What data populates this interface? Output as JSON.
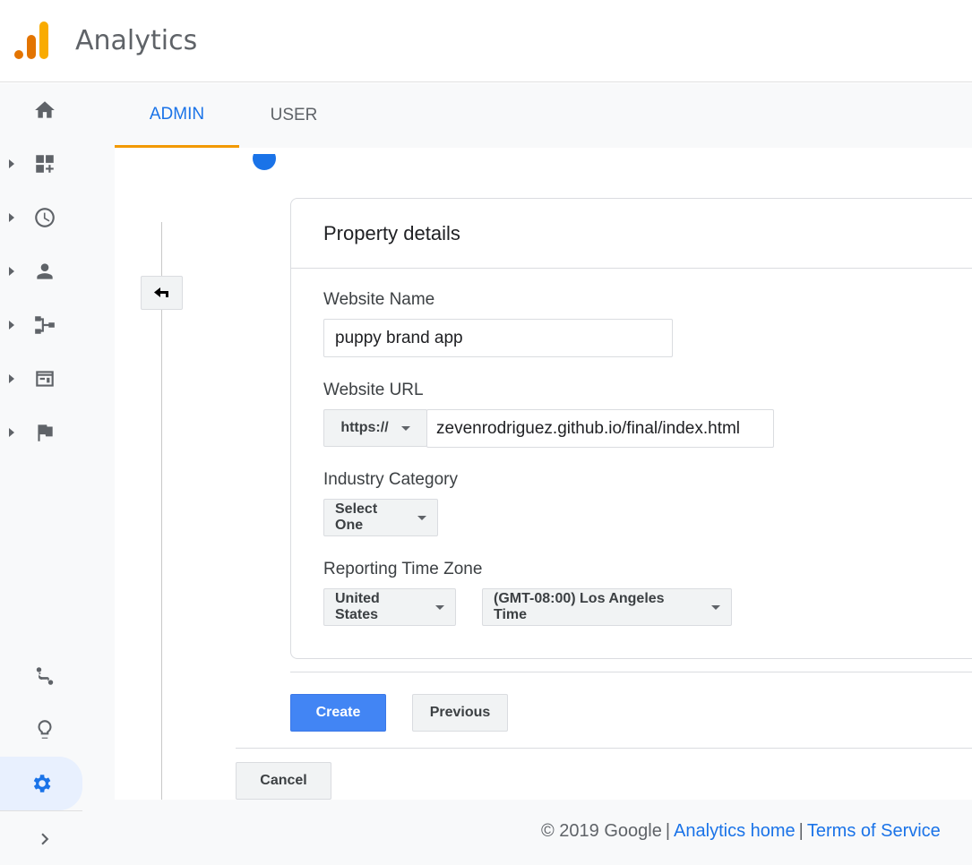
{
  "header": {
    "app_title": "Analytics"
  },
  "tabs": [
    {
      "label": "ADMIN",
      "active": true
    },
    {
      "label": "USER",
      "active": false
    }
  ],
  "rail": {
    "items": [
      "home-icon",
      "customization-icon",
      "realtime-icon",
      "audience-icon",
      "acquisition-icon",
      "behavior-icon",
      "conversions-icon"
    ],
    "bottom": [
      "attribution-icon",
      "discover-icon",
      "admin-gear-icon",
      "expand-icon"
    ]
  },
  "form": {
    "card_title": "Property details",
    "website_name": {
      "label": "Website Name",
      "value": "puppy brand app"
    },
    "website_url": {
      "label": "Website URL",
      "protocol": "https://",
      "value": "zevenrodriguez.github.io/final/index.html"
    },
    "industry": {
      "label": "Industry Category",
      "selected": "Select One"
    },
    "timezone": {
      "label": "Reporting Time Zone",
      "country": "United States",
      "zone": "(GMT-08:00) Los Angeles Time"
    }
  },
  "buttons": {
    "create": "Create",
    "previous": "Previous",
    "cancel": "Cancel"
  },
  "footer": {
    "copyright": "© 2019 Google",
    "sep": "|",
    "home_link": "Analytics home",
    "terms_link": "Terms of Service"
  },
  "colors": {
    "accent": "#1a73e8",
    "tab_indicator": "#f29900",
    "primary_button": "#4285f4"
  }
}
